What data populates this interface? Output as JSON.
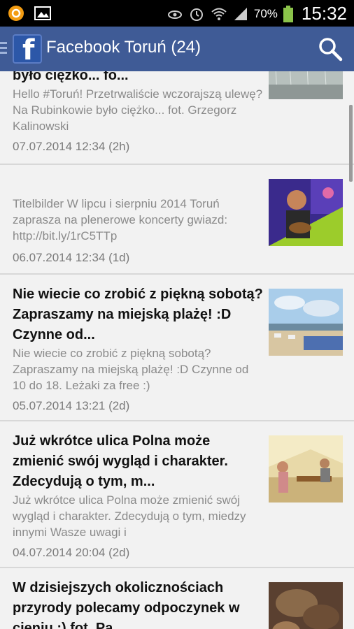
{
  "status_bar": {
    "battery": "70%",
    "time": "15:32"
  },
  "action_bar": {
    "title": "Facebook Toruń (24)",
    "logo_letter": "f"
  },
  "posts": [
    {
      "title": "było ciężko... fo...",
      "description": "Hello #Toruń! Przetrwaliście wczorajszą ulewę? Na Rubinkowie było ciężko... fot. Grzegorz Kalinowski",
      "date": "07.07.2014 12:34 (2h)",
      "thumb": "rain-photo"
    },
    {
      "title": "",
      "description": "Titelbilder W lipcu i sierpniu 2014 Toruń zaprasza na plenerowe koncerty gwiazd: http://bit.ly/1rC5TTp",
      "date": "06.07.2014 12:34 (1d)",
      "thumb": "concert-photo"
    },
    {
      "title": "Nie wiecie co zrobić z piękną sobotą? Zapraszamy na miejską plażę! :D Czynne od...",
      "description": "Nie wiecie co zrobić z piękną sobotą? Zapraszamy na miejską plażę! :D Czynne od 10 do 18. Leżaki za free :)",
      "date": "05.07.2014 13:21 (2d)",
      "thumb": "beach-photo"
    },
    {
      "title": "Już wkrótce ulica Polna może zmienić swój wygląd i charakter. Zdecydują o tym, m...",
      "description": "Już wkrótce ulica Polna może zmienić swój wygląd i charakter. Zdecydują o tym, miedzy innymi Wasze uwagi i",
      "date": "04.07.2014 20:04 (2d)",
      "thumb": "tent-photo"
    },
    {
      "title": "W dzisiejszych okolicznościach przyrody polecamy odpoczynek w cieniu :) fot. Pa...",
      "description": "",
      "date": "",
      "thumb": "tree-photo"
    }
  ]
}
